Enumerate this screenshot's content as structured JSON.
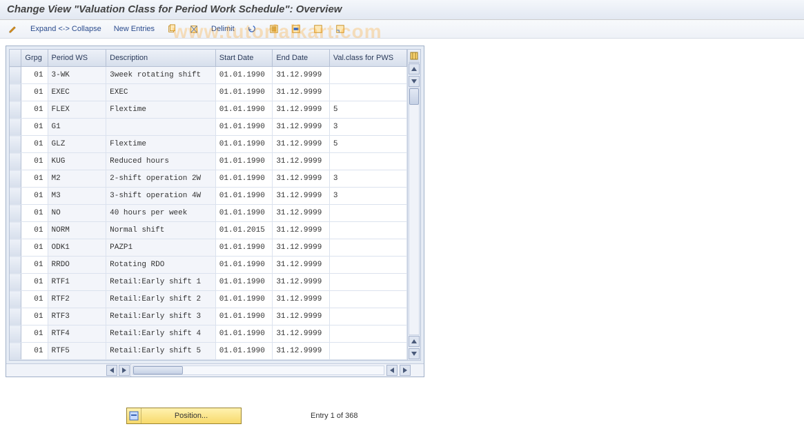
{
  "watermark": "www.tutorialkart.com",
  "title": "Change View \"Valuation Class for Period Work Schedule\": Overview",
  "toolbar": {
    "expand_collapse": "Expand <-> Collapse",
    "new_entries": "New Entries",
    "delimit": "Delimit"
  },
  "columns": {
    "grpg": "Grpg",
    "pws": "Period WS",
    "desc": "Description",
    "start": "Start Date",
    "end": "End Date",
    "val": "Val.class for PWS"
  },
  "rows": [
    {
      "grpg": "01",
      "pws": "3-WK",
      "desc": "3week rotating shift",
      "start": "01.01.1990",
      "end": "31.12.9999",
      "val": ""
    },
    {
      "grpg": "01",
      "pws": "EXEC",
      "desc": "EXEC",
      "start": "01.01.1990",
      "end": "31.12.9999",
      "val": ""
    },
    {
      "grpg": "01",
      "pws": "FLEX",
      "desc": "Flextime",
      "start": "01.01.1990",
      "end": "31.12.9999",
      "val": "5"
    },
    {
      "grpg": "01",
      "pws": "G1",
      "desc": "",
      "start": "01.01.1990",
      "end": "31.12.9999",
      "val": "3"
    },
    {
      "grpg": "01",
      "pws": "GLZ",
      "desc": "Flextime",
      "start": "01.01.1990",
      "end": "31.12.9999",
      "val": "5"
    },
    {
      "grpg": "01",
      "pws": "KUG",
      "desc": "Reduced hours",
      "start": "01.01.1990",
      "end": "31.12.9999",
      "val": ""
    },
    {
      "grpg": "01",
      "pws": "M2",
      "desc": "2-shift operation 2W",
      "start": "01.01.1990",
      "end": "31.12.9999",
      "val": "3"
    },
    {
      "grpg": "01",
      "pws": "M3",
      "desc": "3-shift operation 4W",
      "start": "01.01.1990",
      "end": "31.12.9999",
      "val": "3"
    },
    {
      "grpg": "01",
      "pws": "NO",
      "desc": "40 hours per week",
      "start": "01.01.1990",
      "end": "31.12.9999",
      "val": ""
    },
    {
      "grpg": "01",
      "pws": "NORM",
      "desc": "Normal shift",
      "start": "01.01.2015",
      "end": "31.12.9999",
      "val": ""
    },
    {
      "grpg": "01",
      "pws": "ODK1",
      "desc": "PAZP1",
      "start": "01.01.1990",
      "end": "31.12.9999",
      "val": ""
    },
    {
      "grpg": "01",
      "pws": "RRDO",
      "desc": "Rotating RDO",
      "start": "01.01.1990",
      "end": "31.12.9999",
      "val": ""
    },
    {
      "grpg": "01",
      "pws": "RTF1",
      "desc": "Retail:Early shift 1",
      "start": "01.01.1990",
      "end": "31.12.9999",
      "val": ""
    },
    {
      "grpg": "01",
      "pws": "RTF2",
      "desc": "Retail:Early shift 2",
      "start": "01.01.1990",
      "end": "31.12.9999",
      "val": ""
    },
    {
      "grpg": "01",
      "pws": "RTF3",
      "desc": "Retail:Early shift 3",
      "start": "01.01.1990",
      "end": "31.12.9999",
      "val": ""
    },
    {
      "grpg": "01",
      "pws": "RTF4",
      "desc": "Retail:Early shift 4",
      "start": "01.01.1990",
      "end": "31.12.9999",
      "val": ""
    },
    {
      "grpg": "01",
      "pws": "RTF5",
      "desc": "Retail:Early shift 5",
      "start": "01.01.1990",
      "end": "31.12.9999",
      "val": ""
    }
  ],
  "footer": {
    "position_btn": "Position...",
    "entry_text": "Entry 1 of 368"
  }
}
